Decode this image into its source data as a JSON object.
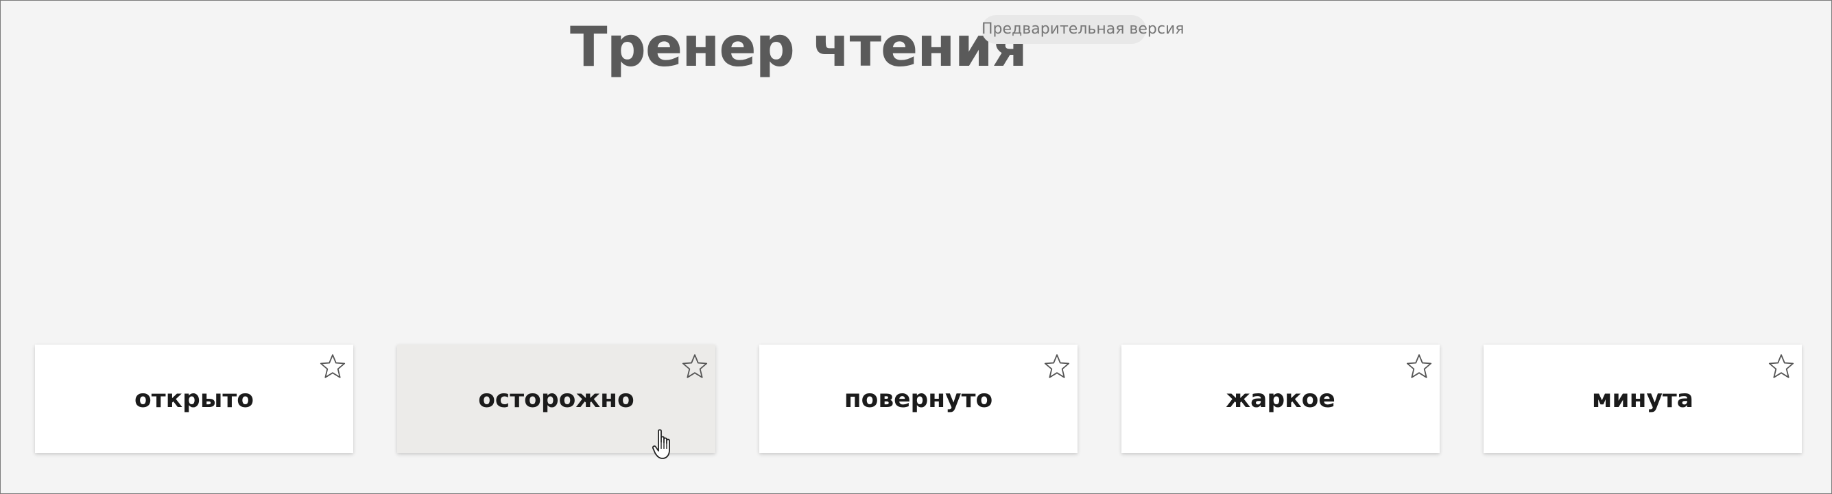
{
  "header": {
    "title": "Тренер чтения",
    "badge": "Предварительная версия"
  },
  "cards": [
    {
      "word": "открыто",
      "hovered": false
    },
    {
      "word": "осторожно",
      "hovered": true
    },
    {
      "word": "повернуто",
      "hovered": false
    },
    {
      "word": "жаркое",
      "hovered": false
    },
    {
      "word": "минута",
      "hovered": false
    }
  ],
  "icons": {
    "favorite": "star-outline-icon",
    "pointer": "hand-pointer-icon"
  },
  "colors": {
    "background": "#f4f4f4",
    "title": "#5a5a5a",
    "badge_bg": "#e8e8e8",
    "card_bg": "#ffffff",
    "card_hover_bg": "#ecebe9"
  }
}
